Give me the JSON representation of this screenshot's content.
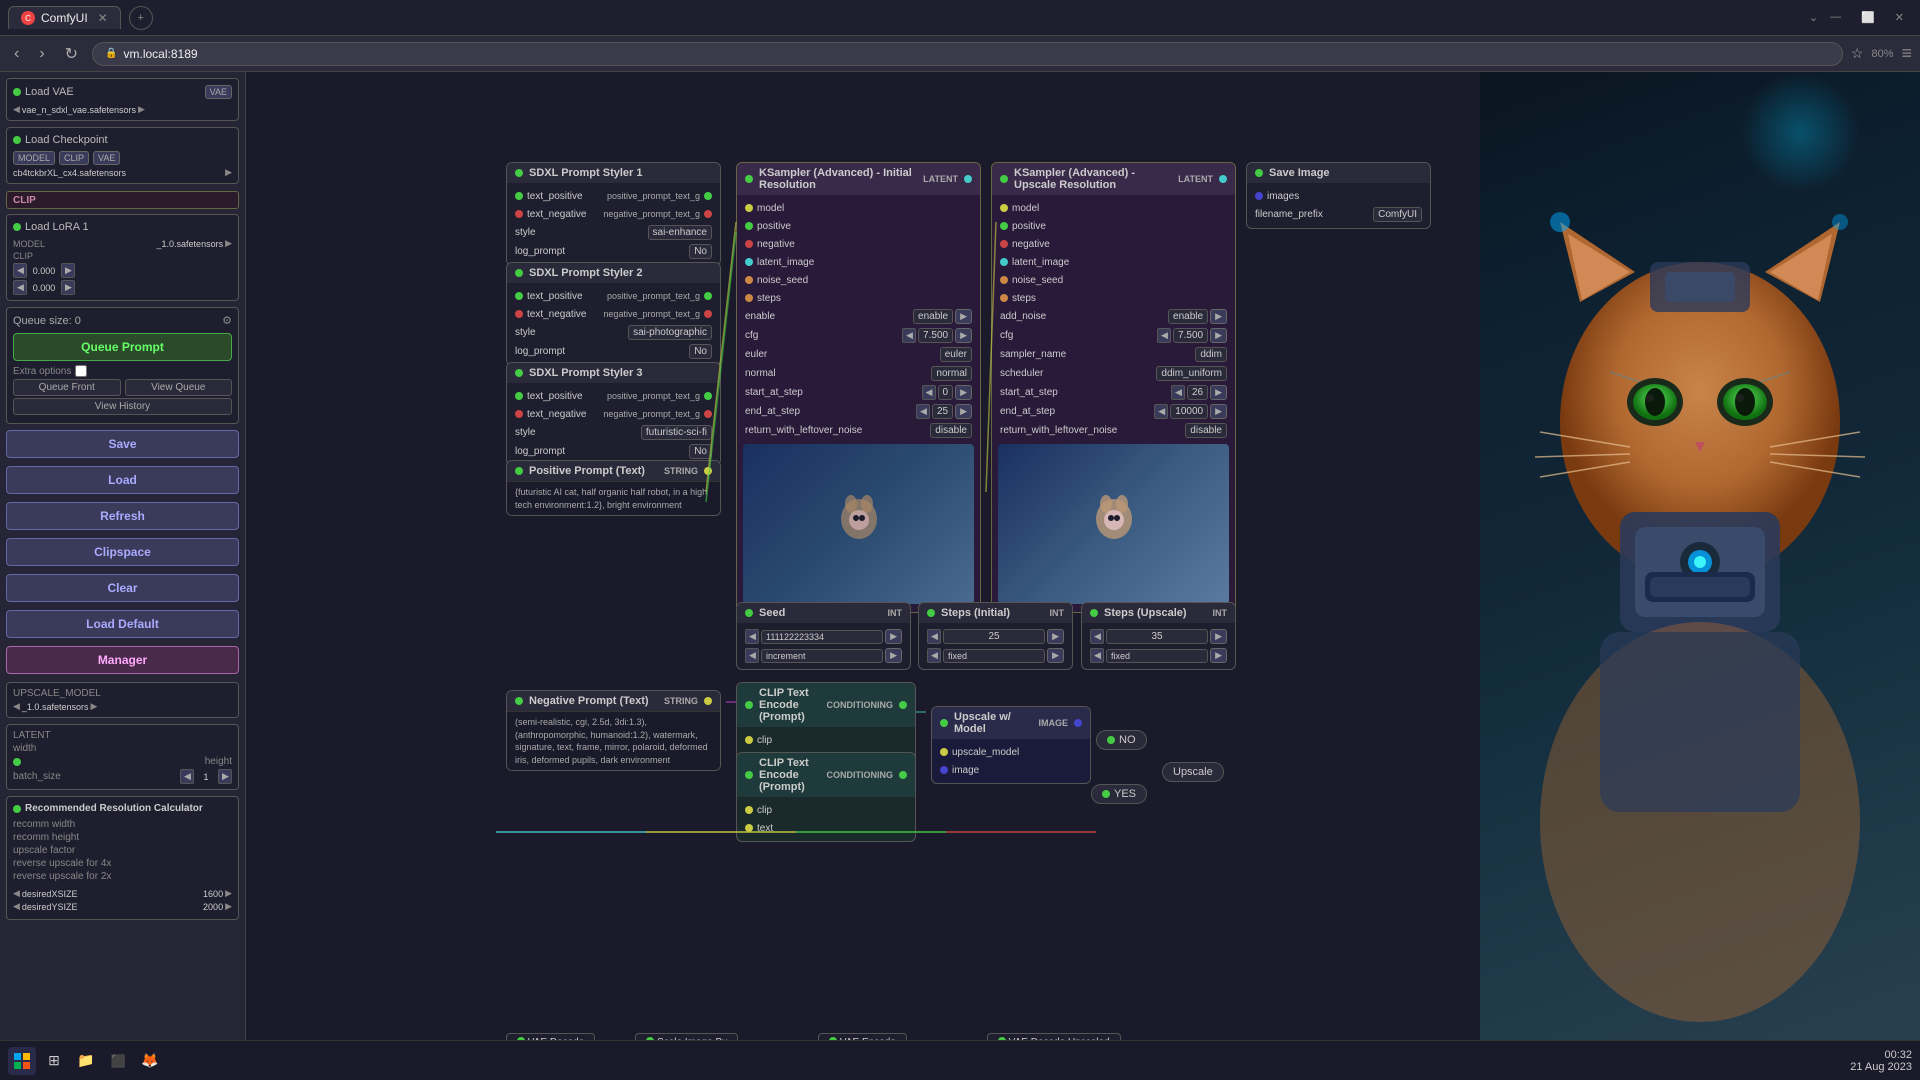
{
  "browser": {
    "tab_title": "ComfyUI",
    "address": "vm.local:8189",
    "zoom": "80%"
  },
  "sidebar": {
    "queue_size_label": "Queue size: 0",
    "queue_prompt_label": "Queue Prompt",
    "extra_options_label": "Extra options",
    "queue_front_label": "Queue Front",
    "view_queue_label": "View Queue",
    "view_history_label": "View History",
    "save_label": "Save",
    "load_label": "Load",
    "refresh_label": "Refresh",
    "clipspace_label": "Clipspace",
    "clear_label": "Clear",
    "load_default_label": "Load Default",
    "manager_label": "Manager",
    "nodes": {
      "load_vae": "Load VAE",
      "load_checkpoint": "Load Checkpoint",
      "load_lora": "Load LoRA 1",
      "vae_name": "vae_n_sdxl_vae.safetensors",
      "model_label": "MODEL",
      "clip_label": "CLIP",
      "vae_label": "VAE",
      "checkpoint_name": "cb4tckbrXL_cx4.safetensors",
      "lora_model": "_1.0.safetensors",
      "lora_value1": "0.000",
      "lora_value2": "0.000",
      "upscale_model_label": "UPSCALE_MODEL",
      "upscale_lora": "_1.0.safetensors",
      "latent_label": "LATENT",
      "width_label": "width",
      "height_label": "height",
      "batch_size_label": "batch_size",
      "batch_size_value": "1"
    },
    "res_calc": {
      "title": "Recommended Resolution Calculator",
      "recomm_width": "recomm width",
      "recomm_height": "recomm height",
      "upscale_factor": "upscale factor",
      "reverse_4x": "reverse upscale for 4x",
      "reverse_2x": "reverse upscale for 2x",
      "desiredXSIZE": "desiredXSIZE",
      "desiredXSIZE_value": "1600",
      "desiredYSIZE": "desiredYSIZE",
      "desiredYSIZE_value": "2000"
    }
  },
  "canvas": {
    "nodes": {
      "sdxl_prompt_1": {
        "title": "SDXL Prompt Styler 1",
        "text_positive": "text_positive",
        "text_positive_out": "positive_prompt_text_g",
        "text_negative": "text_negative",
        "text_negative_out": "negative_prompt_text_g",
        "style_label": "style",
        "style_value": "sai-enhance",
        "log_prompt": "log_prompt",
        "log_value": "No"
      },
      "sdxl_prompt_2": {
        "title": "SDXL Prompt Styler 2",
        "text_positive": "text_positive",
        "text_positive_out": "positive_prompt_text_g",
        "text_negative": "text_negative",
        "text_negative_out": "negative_prompt_text_g",
        "style_label": "style",
        "style_value": "sai-photographic",
        "log_prompt": "log_prompt",
        "log_value": "No"
      },
      "sdxl_prompt_3": {
        "title": "SDXL Prompt Styler 3",
        "text_positive": "text_positive",
        "text_positive_out": "positive_prompt_text_g",
        "text_negative": "text_negative",
        "text_negative_out": "negative_prompt_text_g",
        "style_label": "style",
        "style_value": "futuristic-sci-fi",
        "log_prompt": "log_prompt",
        "log_value": "No"
      },
      "positive_prompt": {
        "title": "Positive Prompt (Text)",
        "output_type": "STRING",
        "text_content": "{futuristic AI cat, half organic half robot, in a high tech environment:1.2}, bright environment"
      },
      "negative_prompt": {
        "title": "Negative Prompt (Text)",
        "output_type": "STRING",
        "text_content": "(semi-realistic, cgi, 2.5d, 3di:1.3), (anthropomorphic, humanoid:1.2), watermark, signature, text, frame, mirror, polaroid, deformed iris, deformed pupils, dark environment"
      },
      "ksampler_initial": {
        "title": "KSampler (Advanced) - Initial Resolution",
        "model": "model",
        "positive": "positive",
        "negative": "negative",
        "latent_image": "latent_image",
        "noise_seed": "noise_seed",
        "steps": "steps",
        "output": "LATENT",
        "add_noise": "enable",
        "cfg": "7.500",
        "sampler_name": "euler",
        "scheduler": "normal",
        "start_at_step": "0",
        "end_at_step": "25",
        "return_with_leftover_noise": "disable"
      },
      "ksampler_upscale": {
        "title": "KSampler (Advanced) - Upscale Resolution",
        "model": "model",
        "positive": "positive",
        "negative": "negative",
        "latent_image": "latent_image",
        "noise_seed": "noise_seed",
        "steps": "steps",
        "output": "LATENT",
        "add_noise": "enable",
        "cfg": "7.500",
        "sampler_name": "ddim",
        "scheduler": "ddim_uniform",
        "start_at_step": "26",
        "end_at_step": "10000",
        "return_with_leftover_noise": "disable"
      },
      "save_image": {
        "title": "Save Image",
        "images": "images",
        "filename_prefix": "ComfyUI"
      },
      "seed": {
        "title": "Seed",
        "type": "INT",
        "value": "111122223334"
      },
      "steps_initial": {
        "title": "Steps (Initial)",
        "type": "INT",
        "value": "25"
      },
      "steps_upscale": {
        "title": "Steps (Upscale)",
        "type": "INT",
        "value": "35"
      },
      "clip_encode_1": {
        "title": "CLIP Text Encode (Prompt)",
        "clip": "clip",
        "text": "text",
        "output": "CONDITIONING"
      },
      "clip_encode_2": {
        "title": "CLIP Text Encode (Prompt)",
        "clip": "clip",
        "text": "text",
        "output": "CONDITIONING"
      },
      "upscale_model": {
        "title": "Upscale w/ Model",
        "upscale_model": "upscale_model",
        "image": "image",
        "output": "IMAGE"
      },
      "vae_decode": {
        "title": "VAE Decode"
      },
      "scale_image": {
        "title": "Scale Image By"
      },
      "vae_encode": {
        "title": "VAE Encode"
      },
      "vae_decode_upscaled": {
        "title": "VAE Decode Upscaled"
      }
    }
  },
  "taskbar": {
    "time": "00:32",
    "date": "21 Aug 2023"
  }
}
